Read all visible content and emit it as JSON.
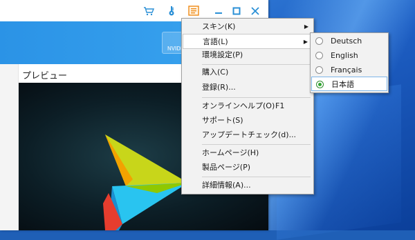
{
  "main_menu": {
    "items": [
      {
        "label": "スキン(K)",
        "submenu": true
      },
      {
        "label": "言語(L)",
        "submenu": true
      },
      {
        "label": "環境設定(P)"
      },
      {
        "label": "購入(C)"
      },
      {
        "label": "登録(R)..."
      },
      {
        "label": "オンラインヘルプ(O)",
        "shortcut": "F1"
      },
      {
        "label": "サポート(S)"
      },
      {
        "label": "アップデートチェック(d)..."
      },
      {
        "label": "ホームページ(H)"
      },
      {
        "label": "製品ページ(P)"
      },
      {
        "label": "詳細情報(A)..."
      }
    ]
  },
  "language_menu": {
    "items": [
      {
        "label": "Deutsch",
        "selected": false
      },
      {
        "label": "English",
        "selected": false
      },
      {
        "label": "Français",
        "selected": false
      },
      {
        "label": "日本語",
        "selected": true
      }
    ]
  },
  "preview": {
    "label": "プレビュー"
  },
  "banner": {
    "badge_text": "NVIDI"
  },
  "icons": {
    "cart": "cart-icon",
    "key": "key-icon",
    "menu": "menu-icon",
    "minimize": "minimize-icon",
    "maximize": "maximize-icon",
    "close": "close-icon"
  },
  "colors": {
    "accent": "#2b93e6",
    "titlebar_icon": "#2a8fd6",
    "menu_icon": "#f08a16",
    "radio_selected": "#2fa52f"
  }
}
